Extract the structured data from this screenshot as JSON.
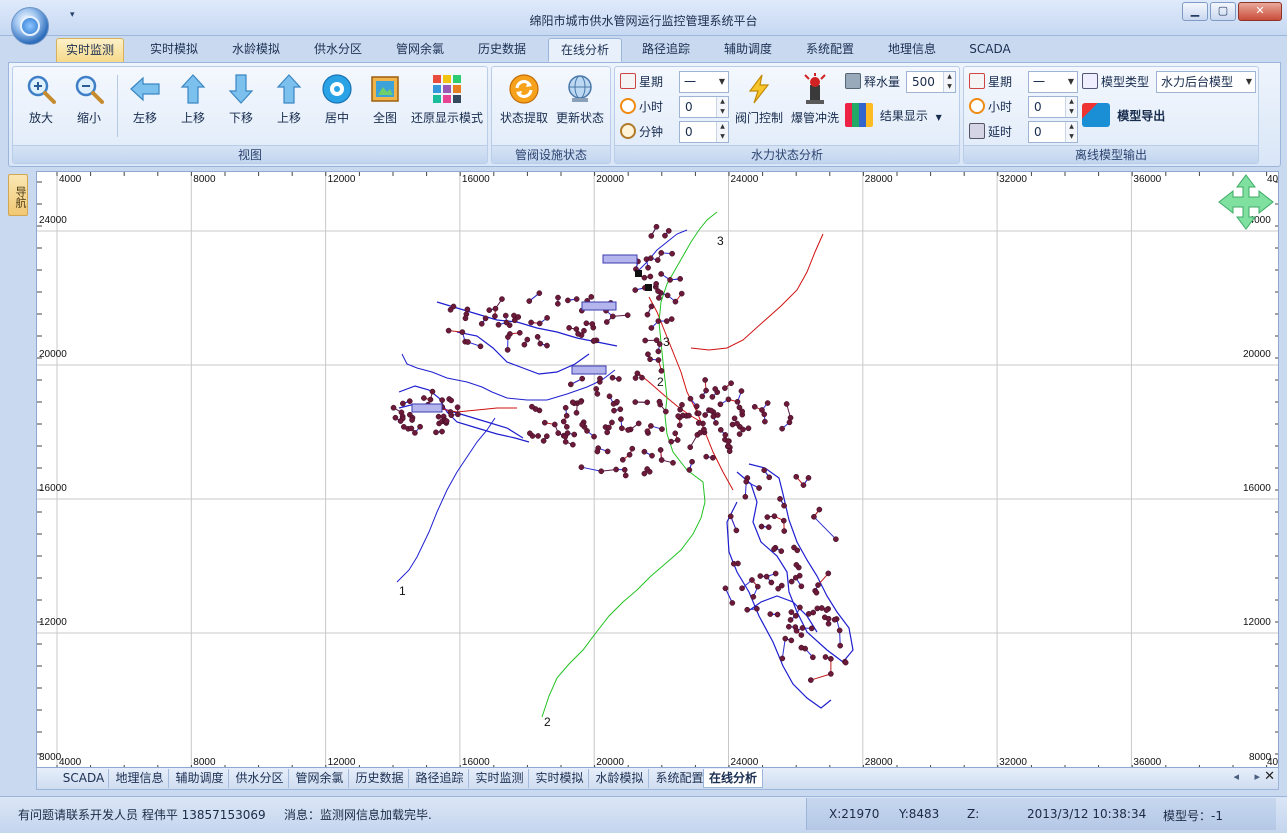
{
  "window": {
    "title": "绵阳市城市供水管网运行监控管理系统平台",
    "qat_arrow": "▾",
    "min": "▁",
    "max": "▢",
    "close": "✕"
  },
  "tabs": [
    "实时监测",
    "实时模拟",
    "水龄模拟",
    "供水分区",
    "管网余氯",
    "历史数据",
    "在线分析",
    "路径追踪",
    "辅助调度",
    "系统配置",
    "地理信息",
    "SCADA"
  ],
  "ribbon": {
    "view_group": {
      "label": "视图",
      "buttons": [
        "放大",
        "缩小",
        "左移",
        "上移",
        "下移",
        "上移",
        "居中",
        "全图",
        "还原显示模式"
      ]
    },
    "valve_group": {
      "label": "管阀设施状态",
      "buttons": [
        "状态提取",
        "更新状态"
      ]
    },
    "hydraulic_group": {
      "label": "水力状态分析",
      "week_label": "星期",
      "week_value": "一",
      "hour_label": "小时",
      "hour_value": "0",
      "minute_label": "分钟",
      "minute_value": "0",
      "valve_control": "阀门控制",
      "burst_flush": "爆管冲洗",
      "release_label": "释水量",
      "release_value": "500",
      "result_display": "结果显示"
    },
    "offline_group": {
      "label": "离线模型输出",
      "week_label": "星期",
      "week_value": "一",
      "hour_label": "小时",
      "hour_value": "0",
      "delay_label": "延时",
      "delay_value": "0",
      "model_type_label": "模型类型",
      "model_type_value": "水力后台模型",
      "model_export": "模型导出"
    }
  },
  "nav_strip": "导航",
  "map": {
    "x_ticks": [
      "4000",
      "8000",
      "12000",
      "16000",
      "20000",
      "24000",
      "28000",
      "32000",
      "36000"
    ],
    "x_tick_edge": "40",
    "y_ticks": [
      "24000",
      "20000",
      "16000",
      "12000"
    ],
    "y_bottom": "8000",
    "y_top_right": "000",
    "line_labels": [
      "1",
      "2",
      "3",
      "3",
      "2"
    ],
    "colors": {
      "blue": "#1f1fd0",
      "red": "#d01010",
      "green": "#22c222",
      "node": "#6b1a3a",
      "grid": "#c8c8c8"
    }
  },
  "doc_tabs": [
    "SCADA",
    "地理信息",
    "辅助调度",
    "供水分区",
    "管网余氯",
    "历史数据",
    "路径追踪",
    "实时监测",
    "实时模拟",
    "水龄模拟",
    "系统配置",
    "在线分析"
  ],
  "doc_nav": "◂ ▸",
  "doc_close": "✕",
  "status": {
    "contact": "有问题请联系开发人员 程伟平 13857153069",
    "message": "消息：监测网信息加载完毕.",
    "x": "X:21970",
    "y": "Y:8483",
    "z": "Z:",
    "datetime": "2013/3/12 10:38:34",
    "model_no": "模型号：-1"
  }
}
